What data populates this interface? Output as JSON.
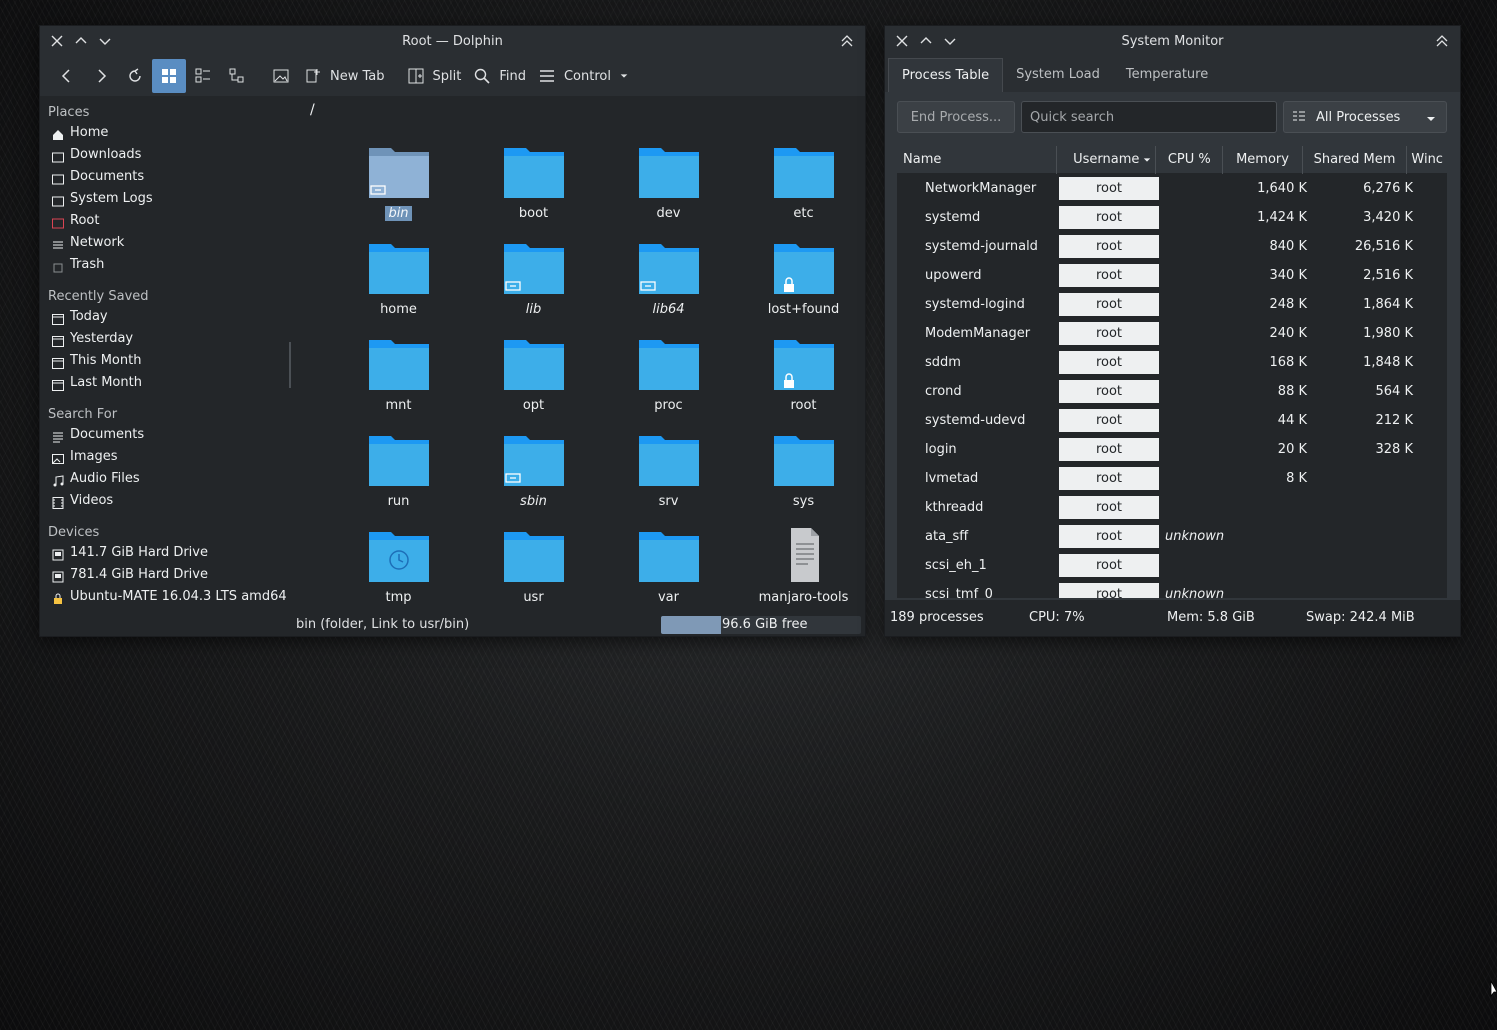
{
  "dolphin": {
    "title": "Root — Dolphin",
    "toolbar": {
      "new_tab": "New Tab",
      "split": "Split",
      "find": "Find",
      "control": "Control"
    },
    "places_head": "Places",
    "places": [
      "Home",
      "Downloads",
      "Documents",
      "System Logs",
      "Root",
      "Network",
      "Trash"
    ],
    "recent_head": "Recently Saved",
    "recent": [
      "Today",
      "Yesterday",
      "This Month",
      "Last Month"
    ],
    "search_head": "Search For",
    "search": [
      "Documents",
      "Images",
      "Audio Files",
      "Videos"
    ],
    "devices_head": "Devices",
    "devices": [
      "141.7 GiB Hard Drive",
      "781.4 GiB Hard Drive",
      "Ubuntu-MATE 16.04.3 LTS amd64"
    ],
    "breadcrumb": "/",
    "items": [
      "bin",
      "boot",
      "dev",
      "etc",
      "home",
      "lib",
      "lib64",
      "lost+found",
      "mnt",
      "opt",
      "proc",
      "root",
      "run",
      "sbin",
      "srv",
      "sys",
      "tmp",
      "usr",
      "var",
      "manjaro-tools"
    ],
    "status": "bin (folder, Link to usr/bin)",
    "free_space": "96.6 GiB free",
    "used_fraction": 0.3
  },
  "sysmon": {
    "title": "System Monitor",
    "tabs": [
      "Process Table",
      "System Load",
      "Temperature"
    ],
    "end_process": "End Process...",
    "search_placeholder": "Quick search",
    "filter": "All Processes",
    "columns": [
      "Name",
      "Username",
      "CPU %",
      "Memory",
      "Shared Mem",
      "Winc"
    ],
    "rows": [
      {
        "name": "NetworkManager",
        "user": "root",
        "cpu": "",
        "mem": "1,640 K",
        "shm": "6,276 K"
      },
      {
        "name": "systemd",
        "user": "root",
        "cpu": "",
        "mem": "1,424 K",
        "shm": "3,420 K"
      },
      {
        "name": "systemd-journald",
        "user": "root",
        "cpu": "",
        "mem": "840 K",
        "shm": "26,516 K"
      },
      {
        "name": "upowerd",
        "user": "root",
        "cpu": "",
        "mem": "340 K",
        "shm": "2,516 K"
      },
      {
        "name": "systemd-logind",
        "user": "root",
        "cpu": "",
        "mem": "248 K",
        "shm": "1,864 K"
      },
      {
        "name": "ModemManager",
        "user": "root",
        "cpu": "",
        "mem": "240 K",
        "shm": "1,980 K"
      },
      {
        "name": "sddm",
        "user": "root",
        "cpu": "",
        "mem": "168 K",
        "shm": "1,848 K"
      },
      {
        "name": "crond",
        "user": "root",
        "cpu": "",
        "mem": "88 K",
        "shm": "564 K"
      },
      {
        "name": "systemd-udevd",
        "user": "root",
        "cpu": "",
        "mem": "44 K",
        "shm": "212 K"
      },
      {
        "name": "login",
        "user": "root",
        "cpu": "",
        "mem": "20 K",
        "shm": "328 K"
      },
      {
        "name": "lvmetad",
        "user": "root",
        "cpu": "",
        "mem": "8 K",
        "shm": ""
      },
      {
        "name": "kthreadd",
        "user": "root",
        "cpu": "",
        "mem": "",
        "shm": ""
      },
      {
        "name": "ata_sff",
        "user": "root",
        "cpu": "unknown",
        "mem": "",
        "shm": ""
      },
      {
        "name": "scsi_eh_1",
        "user": "root",
        "cpu": "",
        "mem": "",
        "shm": ""
      },
      {
        "name": "scsi_tmf_0",
        "user": "root",
        "cpu": "unknown",
        "mem": "",
        "shm": ""
      }
    ],
    "status": {
      "processes": "189 processes",
      "cpu": "CPU: 7%",
      "mem": "Mem: 5.8 GiB",
      "swap": "Swap: 242.4 MiB"
    }
  },
  "colors": {
    "accent": "#5a8dc2",
    "folder": "#3daee9",
    "window_bg": "#232629"
  }
}
